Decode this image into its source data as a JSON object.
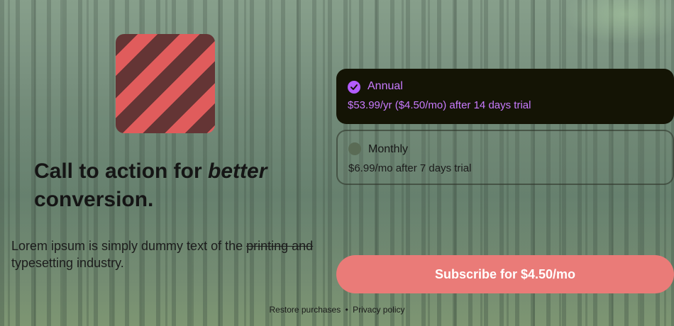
{
  "app": {
    "headline_prefix": "Call to action for ",
    "headline_emphasis": "better",
    "headline_suffix": "conversion.",
    "body_before": "Lorem ipsum is simply dummy text of the ",
    "body_strike": "printing and",
    "body_after": " typesetting industry."
  },
  "plans": [
    {
      "title": "Annual",
      "price": "$53.99/yr ($4.50/mo) after 14 days trial",
      "selected": true
    },
    {
      "title": "Monthly",
      "price": "$6.99/mo after 7 days trial",
      "selected": false
    }
  ],
  "subscribe_label": "Subscribe for $4.50/mo",
  "footer": {
    "restore_label": "Restore purchases",
    "separator": "•",
    "privacy_label": "Privacy policy"
  },
  "colors": {
    "accent": "#c97bff",
    "button": "#ea7b78",
    "logo_dark": "#643535",
    "logo_light": "#e05c5c"
  },
  "icons": [
    "app-logo-icon",
    "check-circle-icon",
    "radio-empty-icon"
  ]
}
